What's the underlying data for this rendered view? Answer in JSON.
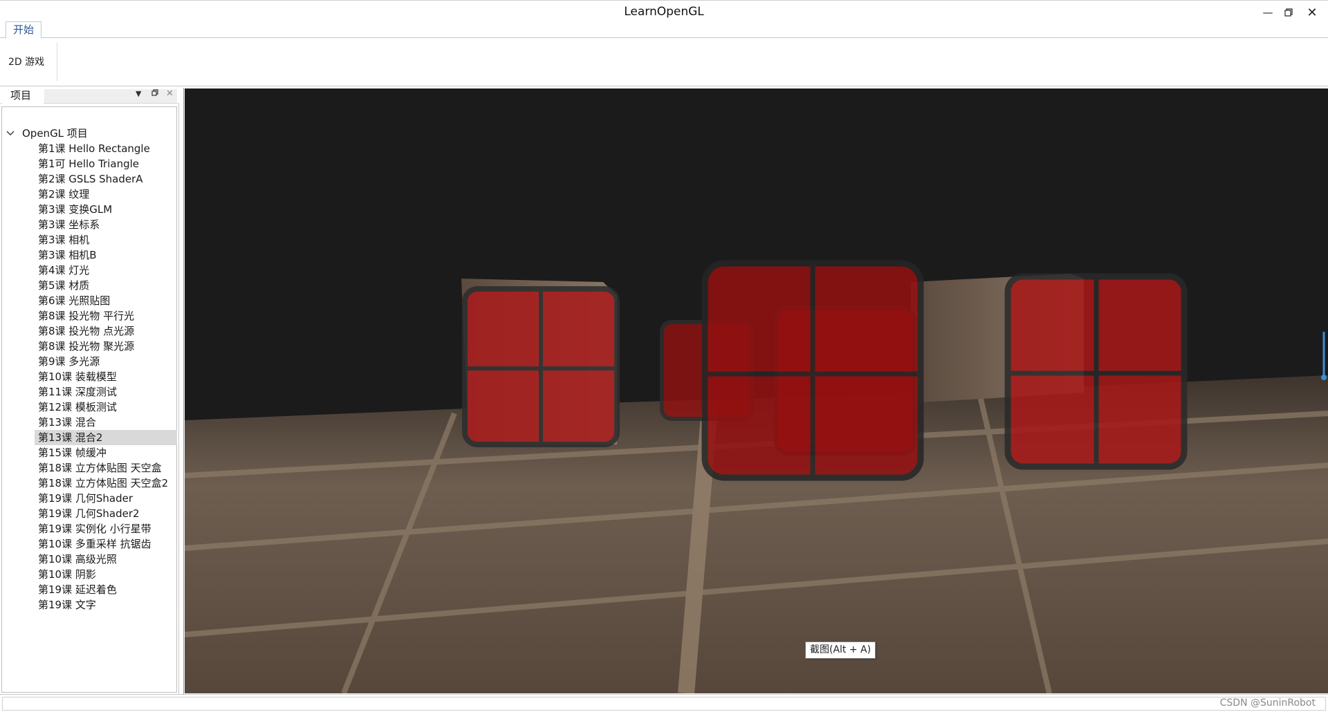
{
  "window": {
    "title": "LearnOpenGL",
    "controls": [
      "minimize-icon",
      "restore-icon",
      "close-icon"
    ]
  },
  "ribbon": {
    "tabs": [
      {
        "label": "开始",
        "active": true
      }
    ],
    "items": [
      {
        "label": "2D 游戏"
      }
    ]
  },
  "project_panel": {
    "tab_label": "项目",
    "root": {
      "label": "OpenGL 项目",
      "expanded": true
    },
    "items": [
      {
        "label": "第1课 Hello Rectangle"
      },
      {
        "label": "第1可 Hello Triangle"
      },
      {
        "label": "第2课 GSLS ShaderA"
      },
      {
        "label": "第2课 纹理"
      },
      {
        "label": "第3课 变换GLM"
      },
      {
        "label": "第3课 坐标系"
      },
      {
        "label": "第3课 相机"
      },
      {
        "label": "第3课 相机B"
      },
      {
        "label": "第4课 灯光"
      },
      {
        "label": "第5课 材质"
      },
      {
        "label": "第6课 光照贴图"
      },
      {
        "label": "第8课 投光物 平行光"
      },
      {
        "label": "第8课 投光物 点光源"
      },
      {
        "label": "第8课 投光物 聚光源"
      },
      {
        "label": "第9课 多光源"
      },
      {
        "label": "第10课 装载模型"
      },
      {
        "label": "第11课 深度测试"
      },
      {
        "label": "第12课 模板测试"
      },
      {
        "label": "第13课 混合"
      },
      {
        "label": "第13课 混合2",
        "selected": true
      },
      {
        "label": "第15课 帧缓冲"
      },
      {
        "label": "第18课 立方体贴图 天空盒"
      },
      {
        "label": "第18课 立方体贴图 天空盒2"
      },
      {
        "label": "第19课 几何Shader"
      },
      {
        "label": "第19课 几何Shader2"
      },
      {
        "label": "第19课 实例化 小行星带"
      },
      {
        "label": "第10课 多重采样 抗锯齿"
      },
      {
        "label": "第10课 高级光照"
      },
      {
        "label": "第10课 阴影"
      },
      {
        "label": "第19课 延迟着色"
      },
      {
        "label": "第19课 文字"
      }
    ]
  },
  "viewport": {
    "tooltip": "截图(Alt + A)",
    "background_color": "#1b1b1b",
    "floor_color": "#6b5a4c",
    "window_tint": "#b01414"
  },
  "status": {
    "watermark": "CSDN @SuninRobot"
  }
}
